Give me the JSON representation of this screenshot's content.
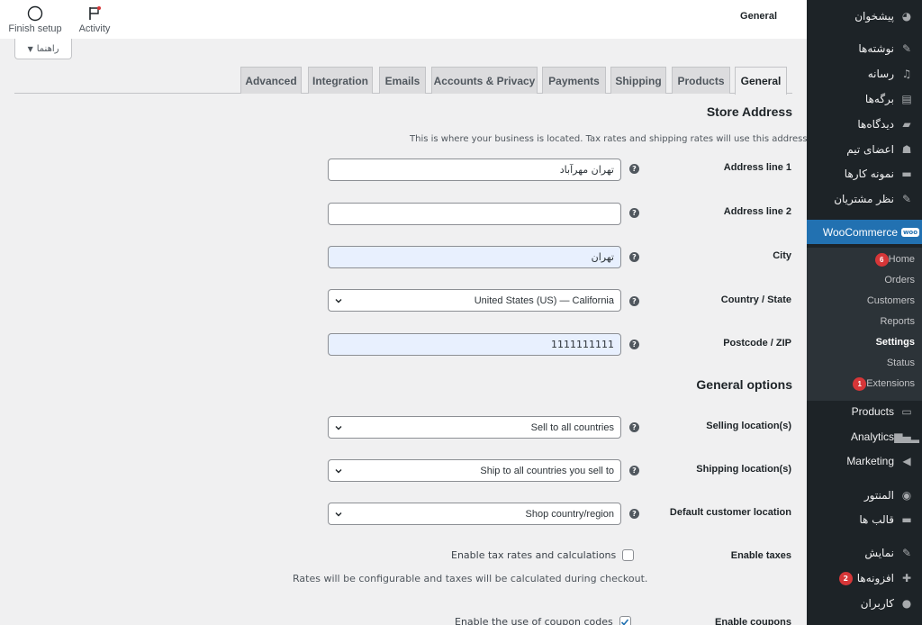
{
  "header": {
    "title": "General",
    "finish_setup_label": "Finish setup",
    "activity_label": "Activity",
    "help_label": "راهنما"
  },
  "tabs": [
    {
      "label": "General",
      "active": true
    },
    {
      "label": "Products"
    },
    {
      "label": "Shipping"
    },
    {
      "label": "Payments"
    },
    {
      "label": "Accounts & Privacy"
    },
    {
      "label": "Emails"
    },
    {
      "label": "Integration"
    },
    {
      "label": "Advanced"
    }
  ],
  "store_address": {
    "heading": "Store Address",
    "description": "This is where your business is located. Tax rates and shipping rates will use this address.",
    "address_line_1_label": "Address line 1",
    "address_line_1_value": "تهران مهرآباد",
    "address_line_2_label": "Address line 2",
    "address_line_2_value": "",
    "city_label": "City",
    "city_value": "تهران",
    "country_label": "Country / State",
    "country_value": "United States (US) — California",
    "postcode_label": "Postcode / ZIP",
    "postcode_value": "1111111111"
  },
  "general_options": {
    "heading": "General options",
    "selling_label": "Selling location(s)",
    "selling_value": "Sell to all countries",
    "shipping_label": "Shipping location(s)",
    "shipping_value": "Ship to all countries you sell to",
    "default_location_label": "Default customer location",
    "default_location_value": "Shop country/region",
    "enable_taxes_label": "Enable taxes",
    "enable_taxes_text": "Enable tax rates and calculations",
    "enable_taxes_checked": false,
    "enable_taxes_desc": "Rates will be configurable and taxes will be calculated during checkout.",
    "enable_coupons_label": "Enable coupons",
    "enable_coupons_text": "Enable the use of coupon codes",
    "enable_coupons_checked": true
  },
  "sidebar": {
    "items": [
      {
        "label": "پیشخوان",
        "icon": "dashboard-icon"
      },
      {
        "label": "نوشته‌ها",
        "icon": "pin-icon"
      },
      {
        "label": "رسانه",
        "icon": "media-icon"
      },
      {
        "label": "برگه‌ها",
        "icon": "page-icon"
      },
      {
        "label": "دیدگاه‌ها",
        "icon": "comment-icon"
      },
      {
        "label": "اعضای تیم",
        "icon": "team-icon"
      },
      {
        "label": "نمونه کارها",
        "icon": "folder-icon"
      },
      {
        "label": "نظر مشتریان",
        "icon": "pin-icon"
      },
      {
        "label": "WooCommerce",
        "icon": "woo-icon",
        "badge": "woo"
      },
      {
        "label": "Products",
        "icon": "products-icon"
      },
      {
        "label": "Analytics",
        "icon": "analytics-icon"
      },
      {
        "label": "Marketing",
        "icon": "megaphone-icon"
      },
      {
        "label": "المنتور",
        "icon": "elementor-icon"
      },
      {
        "label": "قالب ها",
        "icon": "folder-icon"
      },
      {
        "label": "نمایش",
        "icon": "brush-icon"
      },
      {
        "label": "افزونه‌ها",
        "icon": "plugin-icon",
        "count": "2"
      },
      {
        "label": "کاربران",
        "icon": "user-icon"
      }
    ],
    "submenu": [
      {
        "label": "Home",
        "count": "6"
      },
      {
        "label": "Orders"
      },
      {
        "label": "Customers"
      },
      {
        "label": "Reports"
      },
      {
        "label": "Settings",
        "current": true
      },
      {
        "label": "Status"
      },
      {
        "label": "Extensions",
        "count": "1"
      }
    ]
  }
}
